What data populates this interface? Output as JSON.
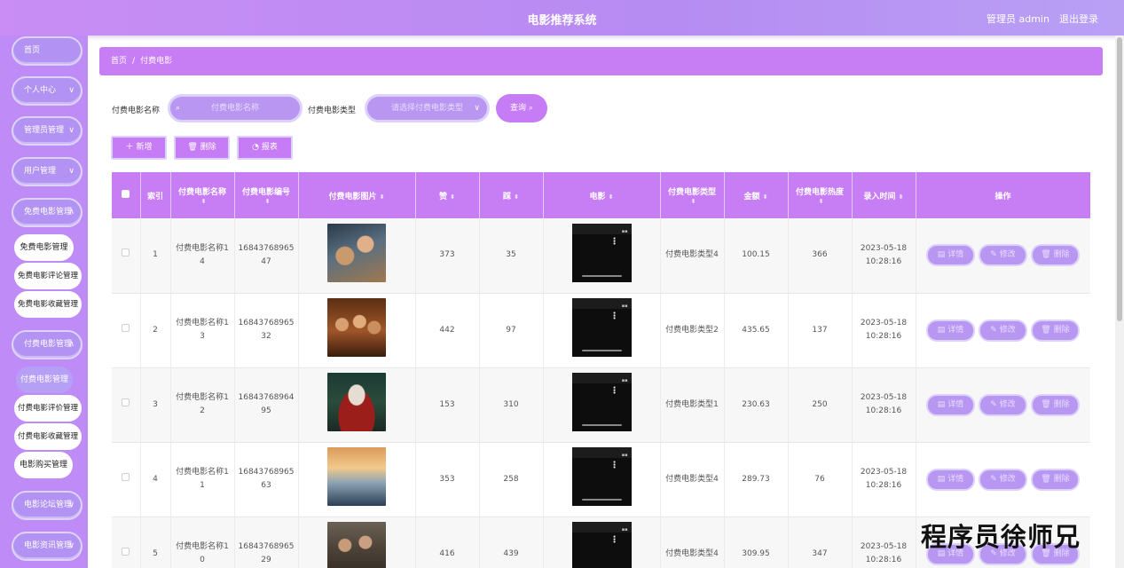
{
  "header": {
    "title": "电影推荐系统",
    "admin": "管理员 admin",
    "logout": "退出登录"
  },
  "sidebar": {
    "menus": [
      {
        "label": "首页",
        "chevron": ""
      },
      {
        "label": "个人中心",
        "chevron": "∨"
      },
      {
        "label": "管理员管理",
        "chevron": "∨"
      },
      {
        "label": "用户管理",
        "chevron": "∨"
      },
      {
        "label": "免费电影管理",
        "chevron": "∧"
      },
      {
        "label": "付费电影管理",
        "chevron": "∧"
      },
      {
        "label": "电影论坛管理",
        "chevron": "∨"
      },
      {
        "label": "电影资讯管理",
        "chevron": "∨"
      }
    ],
    "subs": [
      {
        "label": "免费电影管理"
      },
      {
        "label": "免费电影评论管理"
      },
      {
        "label": "免费电影收藏管理"
      },
      {
        "label": "付费电影管理"
      },
      {
        "label": "付费电影评价管理"
      },
      {
        "label": "付费电影收藏管理"
      },
      {
        "label": "电影购买管理"
      }
    ]
  },
  "breadcrumb": {
    "home": "首页",
    "sep": "/",
    "current": "付费电影"
  },
  "filter": {
    "name_label": "付费电影名称",
    "name_placeholder": "付费电影名称",
    "type_label": "付费电影类型",
    "type_placeholder": "请选择付费电影类型",
    "query": "查询"
  },
  "toolbar": {
    "add": "新增",
    "delete": "删除",
    "report": "报表"
  },
  "table": {
    "headers": [
      "索引",
      "付费电影名称",
      "付费电影编号",
      "付费电影图片",
      "赞",
      "踩",
      "电影",
      "付费电影类型",
      "金额",
      "付费电影热度",
      "录入时间",
      "操作"
    ],
    "rows": [
      {
        "idx": "1",
        "name": "付费电影名称14",
        "code": "1684376896547",
        "up": "373",
        "down": "35",
        "type": "付费电影类型4",
        "amount": "100.15",
        "heat": "366",
        "date": "2023-05-18",
        "time": "10:28:16",
        "poster": "poster-couple"
      },
      {
        "idx": "2",
        "name": "付费电影名称13",
        "code": "1684376896532",
        "up": "442",
        "down": "97",
        "type": "付费电影类型2",
        "amount": "435.65",
        "heat": "137",
        "date": "2023-05-18",
        "time": "10:28:16",
        "poster": "poster-family"
      },
      {
        "idx": "3",
        "name": "付费电影名称12",
        "code": "1684376896495",
        "up": "153",
        "down": "310",
        "type": "付费电影类型1",
        "amount": "230.63",
        "heat": "250",
        "date": "2023-05-18",
        "time": "10:28:16",
        "poster": "poster-joker"
      },
      {
        "idx": "4",
        "name": "付费电影名称11",
        "code": "1684376896563",
        "up": "353",
        "down": "258",
        "type": "付费电影类型4",
        "amount": "289.73",
        "heat": "76",
        "date": "2023-05-18",
        "time": "10:28:16",
        "poster": "poster-titanic"
      },
      {
        "idx": "5",
        "name": "付费电影名称10",
        "code": "1684376896529",
        "up": "416",
        "down": "439",
        "type": "付费电影类型4",
        "amount": "309.95",
        "heat": "347",
        "date": "2023-05-18",
        "time": "10:28:16",
        "poster": "poster-crowd"
      }
    ],
    "ops": {
      "detail": "详情",
      "edit": "修改",
      "delete": "删除"
    }
  },
  "watermark": "程序员徐师兄",
  "colors": {
    "accent": "#c77ef5",
    "sidebar": "#bf8cf7",
    "pill": "#b293f3"
  }
}
